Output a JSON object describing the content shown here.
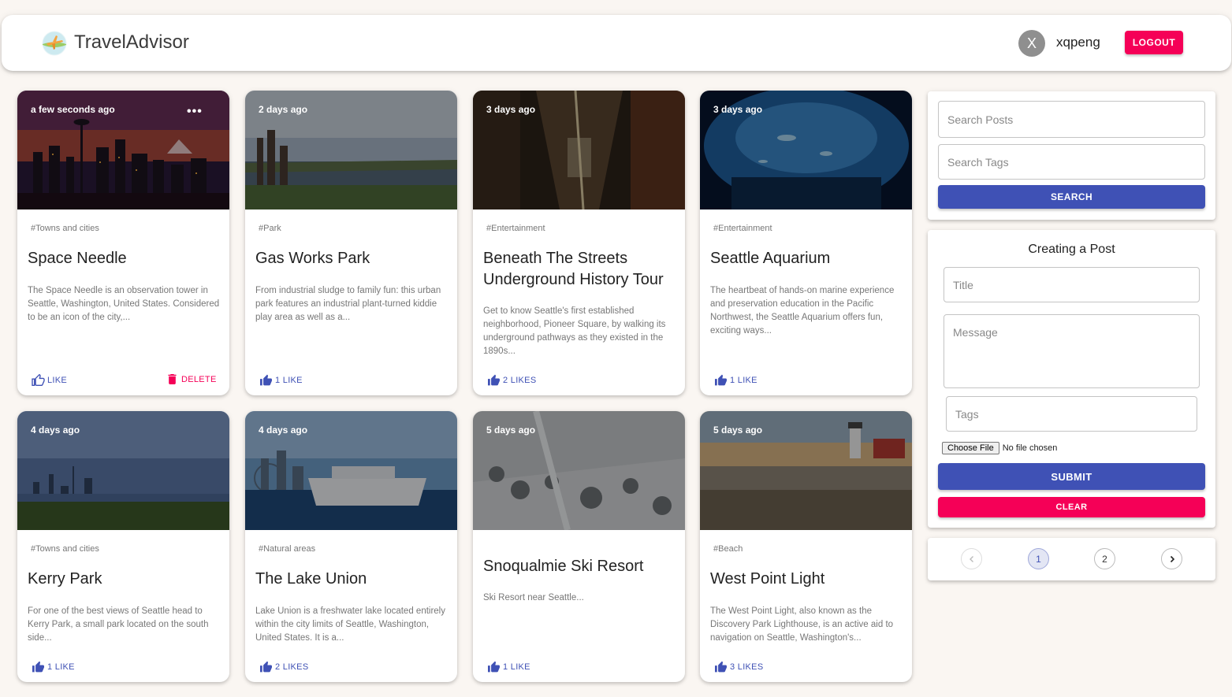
{
  "header": {
    "brand": "TravelAdvisor",
    "avatar_initial": "X",
    "username": "xqpeng",
    "logout_label": "LOGOUT"
  },
  "posts": [
    {
      "time": "a few seconds ago",
      "tag": "#Towns and cities",
      "title": "Space Needle",
      "description": "The Space Needle is an observation tower in Seattle, Washington, United States. Considered to be an icon of the city,...",
      "likes": "LIKE",
      "delete_label": "DELETE",
      "image": "city-sunset"
    },
    {
      "time": "2 days ago",
      "tag": "#Park",
      "title": "Gas Works Park",
      "description": "From industrial sludge to family fun: this urban park features an industrial plant-turned kiddie play area as well as a...",
      "likes": "1 LIKE",
      "image": "park-lake"
    },
    {
      "time": "3 days ago",
      "tag": "#Entertainment",
      "title": "Beneath The Streets Underground History Tour",
      "description": "Get to know Seattle's first established neighborhood, Pioneer Square, by walking its underground pathways as they existed in the 1890s...",
      "likes": "2 LIKES",
      "image": "tunnel"
    },
    {
      "time": "3 days ago",
      "tag": "#Entertainment",
      "title": "Seattle Aquarium",
      "description": "The heartbeat of hands-on marine experience and preservation education in the Pacific Northwest, the Seattle Aquarium offers fun, exciting ways...",
      "likes": "1 LIKE",
      "image": "aquarium"
    },
    {
      "time": "4 days ago",
      "tag": "#Towns and cities",
      "title": "Kerry Park",
      "description": "For one of the best views of Seattle head to Kerry Park, a small park located on the south side...",
      "likes": "1 LIKE",
      "image": "skyline"
    },
    {
      "time": "4 days ago",
      "tag": "#Natural areas",
      "title": "The Lake Union",
      "description": "Lake Union is a freshwater lake located entirely within the city limits of Seattle, Washington, United States. It is a...",
      "likes": "2 LIKES",
      "image": "ferry"
    },
    {
      "time": "5 days ago",
      "tag": "",
      "title": "Snoqualmie Ski Resort",
      "description": "Ski Resort near Seattle...",
      "likes": "1 LIKE",
      "image": "snow"
    },
    {
      "time": "5 days ago",
      "tag": "#Beach",
      "title": "West Point Light",
      "description": "The West Point Light, also known as the Discovery Park Lighthouse, is an active aid to navigation on Seattle, Washington's...",
      "likes": "3 LIKES",
      "image": "lighthouse"
    }
  ],
  "search": {
    "posts_placeholder": "Search Posts",
    "tags_placeholder": "Search Tags",
    "button_label": "SEARCH"
  },
  "form": {
    "heading": "Creating a Post",
    "title_placeholder": "Title",
    "message_placeholder": "Message",
    "tags_placeholder": "Tags",
    "file_button": "Choose File",
    "file_status": "No file chosen",
    "submit_label": "SUBMIT",
    "clear_label": "CLEAR"
  },
  "pagination": {
    "pages": [
      "1",
      "2"
    ],
    "current": "1"
  },
  "colors": {
    "primary": "#3f51b5",
    "secondary": "#f50057",
    "background": "#faf6f2"
  }
}
